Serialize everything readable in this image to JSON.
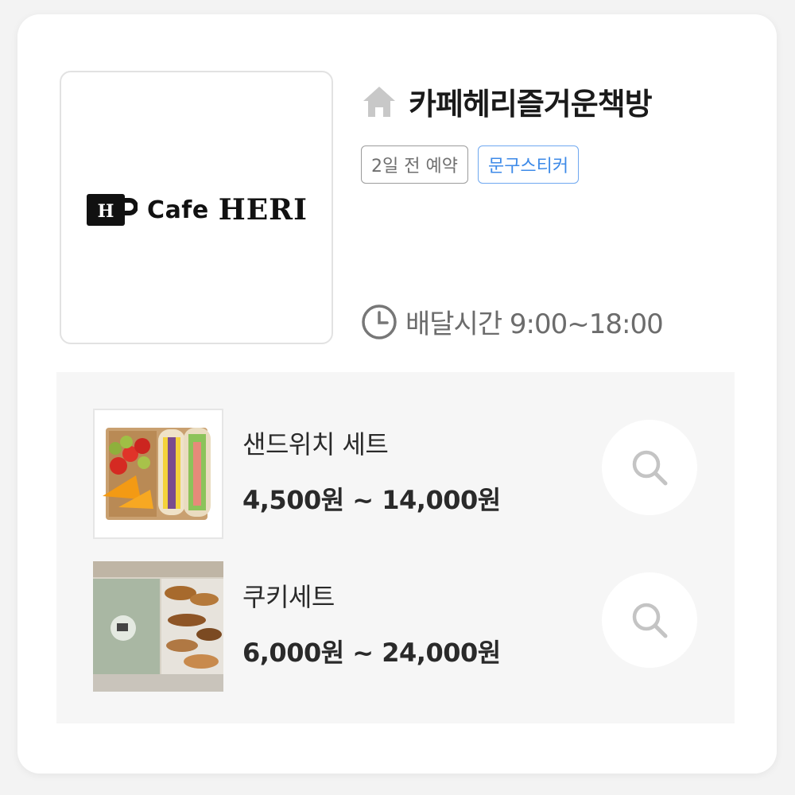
{
  "store": {
    "name": "카페헤리즐거운책방",
    "logo_brand": "Cafe",
    "logo_name": "HERI",
    "logo_cup_letter": "H",
    "tags": [
      {
        "label": "2일 전 예약",
        "style": "gray"
      },
      {
        "label": "문구스티커",
        "style": "blue"
      }
    ],
    "delivery_time": "배달시간 9:00~18:00"
  },
  "menu": [
    {
      "name": "샌드위치 세트",
      "price": "4,500원 ~ 14,000원",
      "thumb_icon": "sandwich-photo"
    },
    {
      "name": "쿠키세트",
      "price": "6,000원 ~ 24,000원",
      "thumb_icon": "cookie-box-photo"
    }
  ],
  "icons": {
    "home": "home-icon",
    "clock": "clock-icon",
    "search": "search-icon"
  },
  "colors": {
    "tag_blue": "#3d8ae8",
    "tag_gray": "#6f6f6f",
    "icon_gray": "#c8c8c8",
    "panel_bg": "#f6f6f6"
  }
}
